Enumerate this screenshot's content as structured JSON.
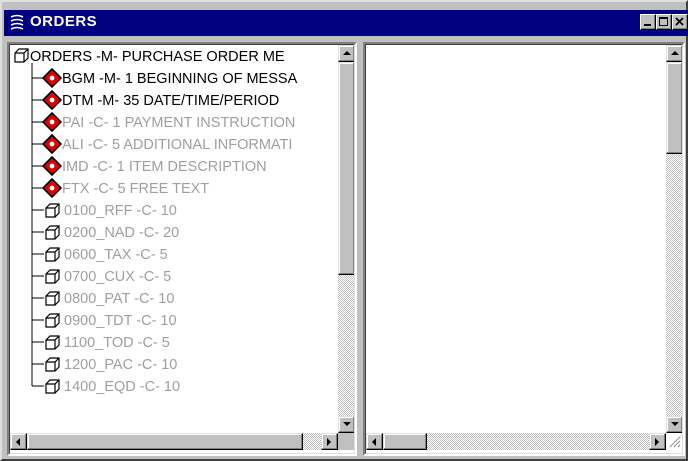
{
  "window": {
    "title": "ORDERS",
    "icon": "orders-app-icon",
    "controls": [
      "minimize-icon",
      "maximize-icon",
      "close-icon"
    ]
  },
  "colors": {
    "titlebar": "#000080",
    "active_text": "#000000",
    "disabled_text": "#a0a0a0",
    "segment_icon_red": "#e00000"
  },
  "tree": {
    "root": {
      "label": "ORDERS -M- PURCHASE ORDER ME",
      "icon": "segment-group-icon"
    },
    "items": [
      {
        "label": "BGM -M- 1 BEGINNING OF MESSA",
        "icon": "segment-icon",
        "state": "enabled"
      },
      {
        "label": "DTM -M- 35 DATE/TIME/PERIOD",
        "icon": "segment-icon",
        "state": "enabled"
      },
      {
        "label": "PAI -C- 1 PAYMENT INSTRUCTION",
        "icon": "segment-icon",
        "state": "disabled"
      },
      {
        "label": "ALI -C- 5 ADDITIONAL INFORMATI",
        "icon": "segment-icon",
        "state": "disabled"
      },
      {
        "label": "IMD -C- 1 ITEM DESCRIPTION",
        "icon": "segment-icon",
        "state": "disabled"
      },
      {
        "label": "FTX -C- 5 FREE TEXT",
        "icon": "segment-icon",
        "state": "disabled"
      },
      {
        "label": "0100_RFF -C- 10",
        "icon": "group-icon",
        "state": "disabled"
      },
      {
        "label": "0200_NAD -C- 20",
        "icon": "group-icon",
        "state": "disabled"
      },
      {
        "label": "0600_TAX -C- 5",
        "icon": "group-icon",
        "state": "disabled"
      },
      {
        "label": "0700_CUX -C- 5",
        "icon": "group-icon",
        "state": "disabled"
      },
      {
        "label": "0800_PAT -C- 10",
        "icon": "group-icon",
        "state": "disabled"
      },
      {
        "label": "0900_TDT -C- 10",
        "icon": "group-icon",
        "state": "disabled"
      },
      {
        "label": "1100_TOD -C- 5",
        "icon": "group-icon",
        "state": "disabled"
      },
      {
        "label": "1200_PAC -C- 10",
        "icon": "group-icon",
        "state": "disabled"
      },
      {
        "label": "1400_EQD -C- 10",
        "icon": "group-icon",
        "state": "disabled"
      }
    ]
  },
  "scrollbars": {
    "left_vertical": {
      "thumb_position": 0.0,
      "visible_fraction": 0.55
    },
    "left_horizontal": {
      "thumb_position": 0.0,
      "visible_fraction": 0.95
    },
    "right_vertical": {
      "thumb_position": 0.0,
      "visible_fraction": 0.25
    },
    "right_horizontal": {
      "thumb_position": 0.0,
      "visible_fraction": 0.15
    }
  }
}
